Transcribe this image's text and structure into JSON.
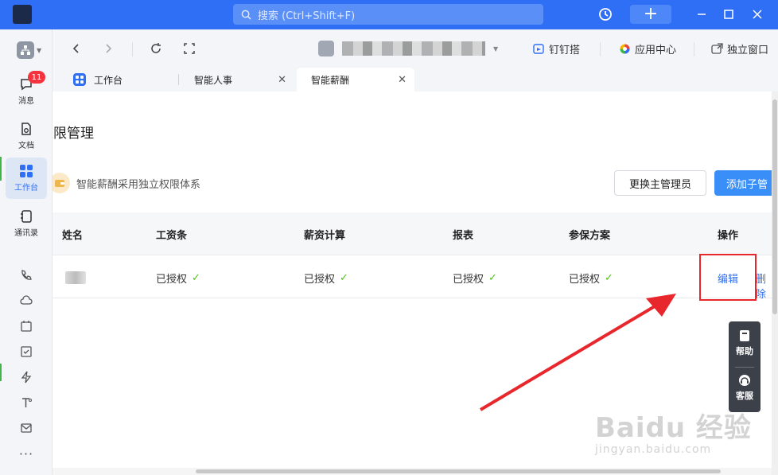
{
  "topbar": {
    "search_placeholder": "搜索 (Ctrl+Shift+F)"
  },
  "rail": {
    "badge": "11",
    "items": [
      {
        "label": "消息",
        "icon": "chat-icon"
      },
      {
        "label": "文档",
        "icon": "document-icon"
      },
      {
        "label": "工作台",
        "icon": "apps-grid-icon"
      },
      {
        "label": "通讯录",
        "icon": "contacts-icon"
      }
    ]
  },
  "toolbar": {
    "links": [
      "钉钉搭",
      "应用中心",
      "独立窗口"
    ]
  },
  "tabs": [
    {
      "label": "工作台"
    },
    {
      "label": "智能人事"
    },
    {
      "label": "智能薪酬"
    }
  ],
  "page": {
    "title": "权限管理",
    "notice": "智能薪酬采用独立权限体系",
    "btn_change_admin": "更换主管理员",
    "btn_add_sub_admin": "添加子管"
  },
  "table": {
    "headers": [
      "姓名",
      "工资条",
      "薪资计算",
      "报表",
      "参保方案",
      "操作"
    ],
    "rows": [
      {
        "cells": [
          "已授权",
          "已授权",
          "已授权",
          "已授权"
        ],
        "actions": [
          "编辑",
          "删除"
        ]
      }
    ]
  },
  "help_widget": {
    "help": "帮助",
    "service": "客服"
  },
  "watermark": {
    "main": "Baidu 经验",
    "sub": "jingyan.baidu.com"
  },
  "colors": {
    "brand_blue": "#2f6ff5",
    "badge_red": "#f5333f",
    "check_green": "#52c41a",
    "annotation_red": "#e8272d"
  }
}
